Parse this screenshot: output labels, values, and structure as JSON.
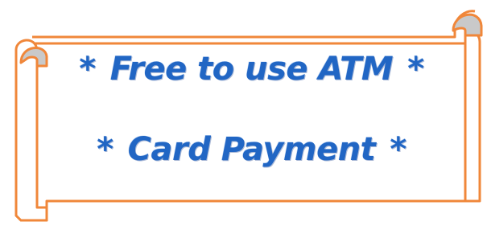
{
  "banner": {
    "line1": {
      "bullet_left": "*",
      "text": "Free to use ATM",
      "bullet_right": "*"
    },
    "line2": {
      "bullet_left": "*",
      "text": "Card Payment",
      "bullet_right": "*"
    }
  },
  "colors": {
    "border": "#f0873a",
    "fill": "#ffffff",
    "curl_fill": "#c9c9c9",
    "text": "#2166c4"
  }
}
